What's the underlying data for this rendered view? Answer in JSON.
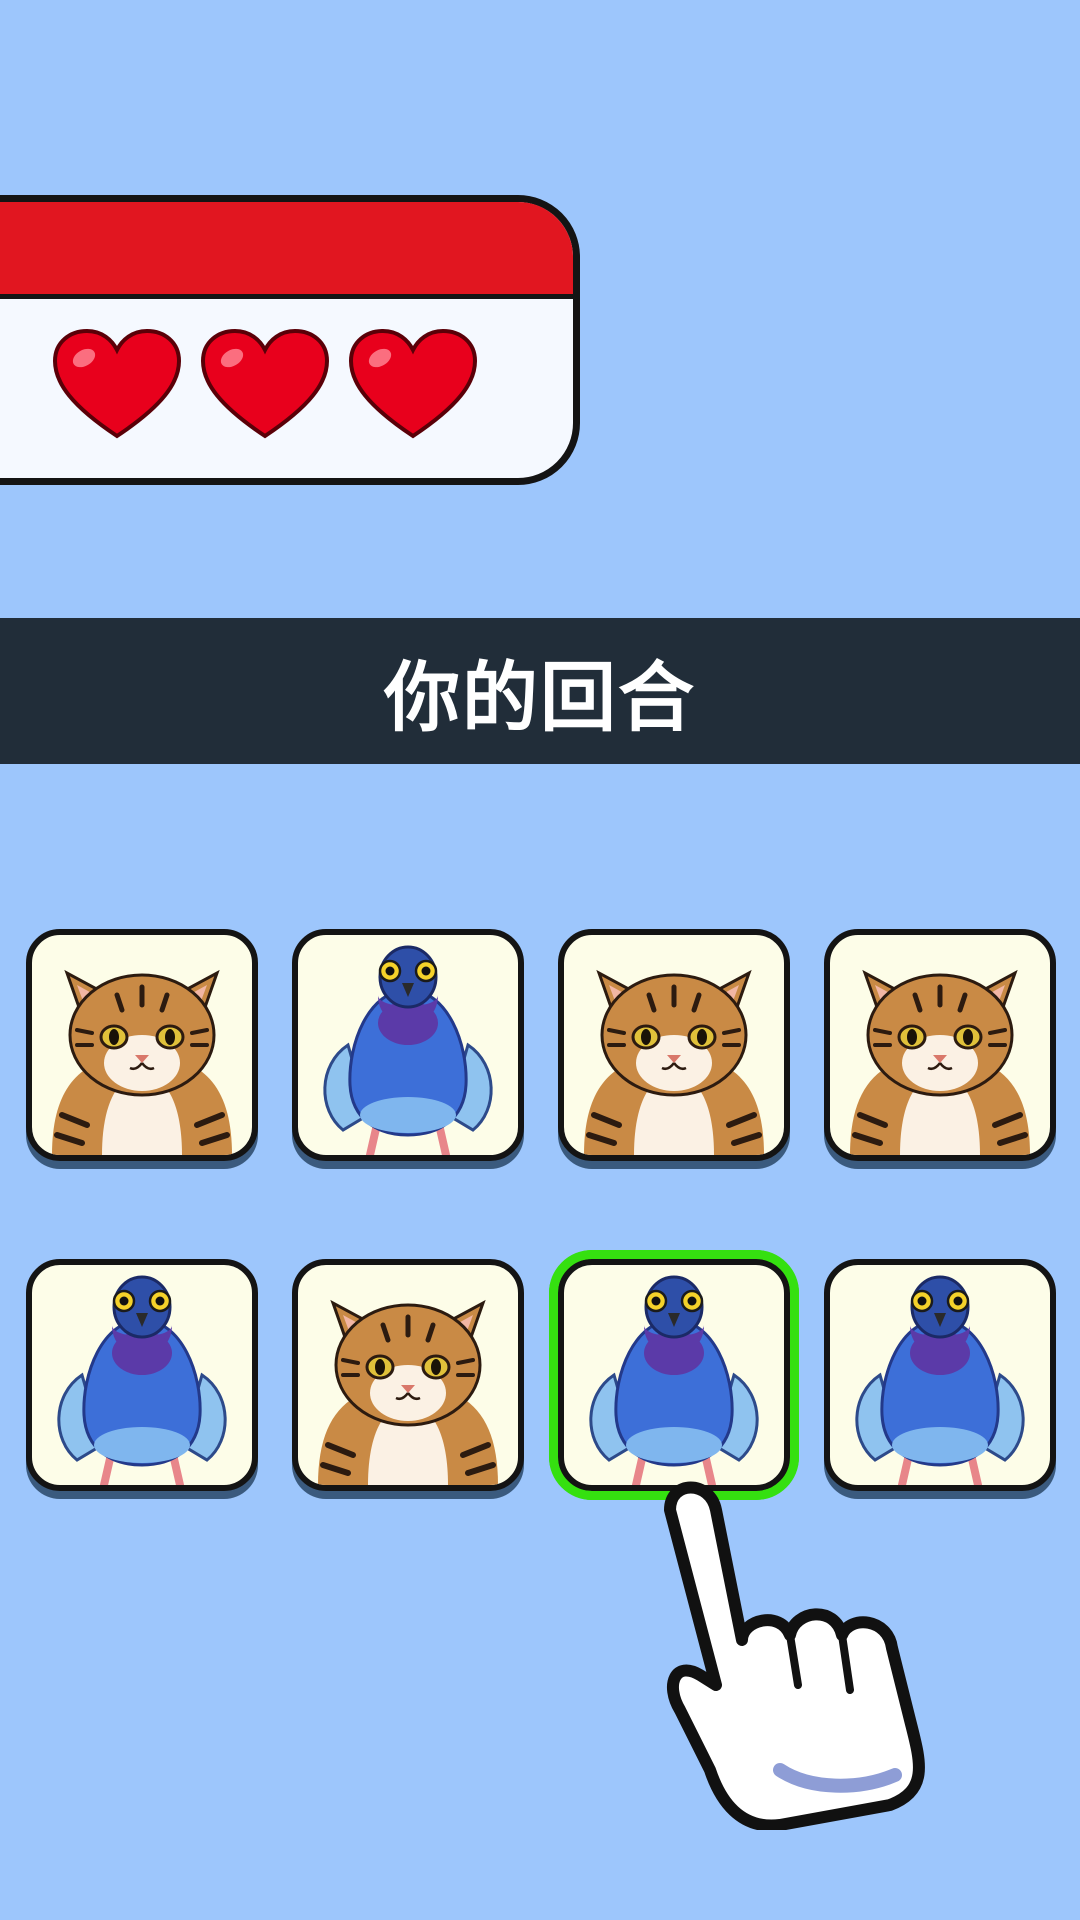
{
  "lives": {
    "count": 3,
    "max": 3,
    "heart_color": "#e8001c"
  },
  "turn_banner": {
    "text": "你的回合"
  },
  "board": {
    "rows": [
      [
        {
          "animal": "cat"
        },
        {
          "animal": "pigeon"
        },
        {
          "animal": "cat"
        },
        {
          "animal": "cat"
        }
      ],
      [
        {
          "animal": "pigeon"
        },
        {
          "animal": "cat"
        },
        {
          "animal": "pigeon",
          "selected": true
        },
        {
          "animal": "pigeon"
        }
      ]
    ],
    "highlight_color": "#35e010"
  },
  "hint": {
    "icon": "pointing-hand-icon"
  }
}
